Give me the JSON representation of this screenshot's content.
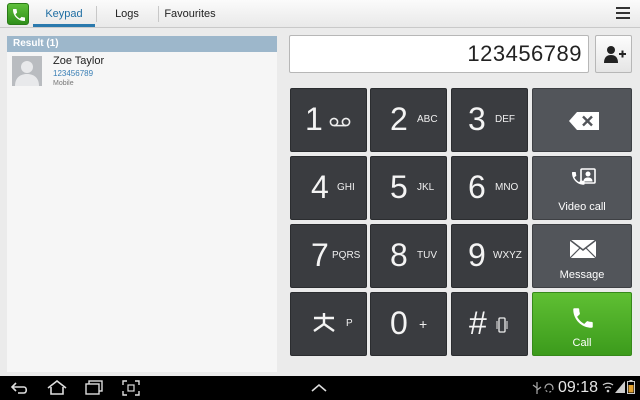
{
  "tabs": [
    {
      "label": "Keypad",
      "active": true
    },
    {
      "label": "Logs",
      "active": false
    },
    {
      "label": "Favourites",
      "active": false
    }
  ],
  "results": {
    "header": "Result (1)",
    "contact": {
      "name": "Zoe Taylor",
      "number": "123456789",
      "type": "Mobile"
    }
  },
  "dialer": {
    "number": "123456789"
  },
  "keypad": [
    {
      "digit": "1",
      "letters": ""
    },
    {
      "digit": "2",
      "letters": "ABC"
    },
    {
      "digit": "3",
      "letters": "DEF"
    },
    {
      "digit": "4",
      "letters": "GHI"
    },
    {
      "digit": "5",
      "letters": "JKL"
    },
    {
      "digit": "6",
      "letters": "MNO"
    },
    {
      "digit": "7",
      "letters": "PQRS"
    },
    {
      "digit": "8",
      "letters": "TUV"
    },
    {
      "digit": "9",
      "letters": "WXYZ"
    },
    {
      "digit": "*",
      "letters": "P"
    },
    {
      "digit": "0",
      "letters": "+"
    },
    {
      "digit": "#",
      "letters": ""
    }
  ],
  "actions": {
    "video_call": "Video call",
    "message": "Message",
    "call": "Call"
  },
  "status": {
    "time": "09:18"
  },
  "colors": {
    "accent": "#2a79ad",
    "call_green": "#4cae27",
    "key_dark": "#3a3c40"
  }
}
